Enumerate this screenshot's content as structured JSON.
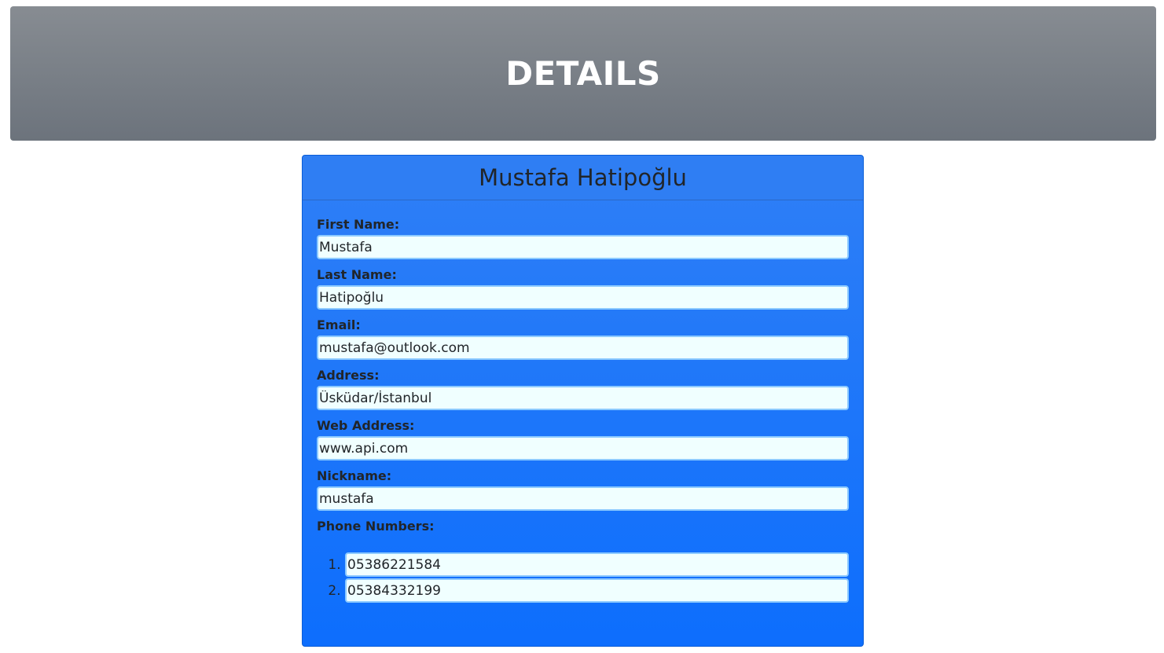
{
  "header": {
    "title": "DETAILS"
  },
  "card": {
    "title": "Mustafa Hatipoğlu",
    "fields": [
      {
        "label": "First Name:",
        "value": "Mustafa"
      },
      {
        "label": "Last Name:",
        "value": "Hatipoğlu"
      },
      {
        "label": "Email:",
        "value": "mustafa@outlook.com"
      },
      {
        "label": "Address:",
        "value": "Üsküdar/İstanbul"
      },
      {
        "label": "Web Address:",
        "value": "www.api.com"
      },
      {
        "label": "Nickname:",
        "value": "mustafa"
      }
    ],
    "phones_label": "Phone Numbers:",
    "phones": [
      "05386221584",
      "05384332199"
    ]
  }
}
